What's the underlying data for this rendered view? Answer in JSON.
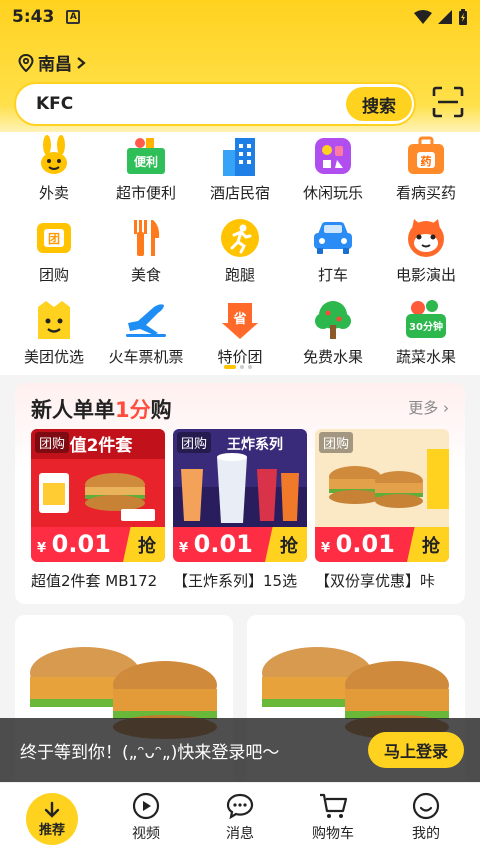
{
  "status": {
    "time": "5:43",
    "notif": "A"
  },
  "location": {
    "city": "南昌"
  },
  "search": {
    "query": "KFC",
    "button": "搜索"
  },
  "categories": [
    {
      "label": "外卖",
      "icon": "kangaroo-icon"
    },
    {
      "label": "超市便利",
      "icon": "supermarket-icon",
      "badge": "便利"
    },
    {
      "label": "酒店民宿",
      "icon": "hotel-icon"
    },
    {
      "label": "休闲玩乐",
      "icon": "leisure-icon"
    },
    {
      "label": "看病买药",
      "icon": "medicine-icon",
      "badge": "药"
    },
    {
      "label": "团购",
      "icon": "group-buy-icon",
      "badge": "团"
    },
    {
      "label": "美食",
      "icon": "fork-knife-icon"
    },
    {
      "label": "跑腿",
      "icon": "errand-icon"
    },
    {
      "label": "打车",
      "icon": "car-icon"
    },
    {
      "label": "电影演出",
      "icon": "cat-movie-icon"
    },
    {
      "label": "美团优选",
      "icon": "bag-icon"
    },
    {
      "label": "火车票机票",
      "icon": "plane-icon"
    },
    {
      "label": "特价团",
      "icon": "discount-icon",
      "badge": "省"
    },
    {
      "label": "免费水果",
      "icon": "tree-icon"
    },
    {
      "label": "蔬菜水果",
      "icon": "veg-icon",
      "badge": "30分钟"
    }
  ],
  "newuser": {
    "title_prefix": "新人单单",
    "title_highlight": "1分",
    "title_suffix": "购",
    "more": "更多",
    "deals": [
      {
        "tag": "团购",
        "currency": "¥",
        "price": "0.01",
        "grab": "抢",
        "name": "超值2件套 MB172",
        "banner": "值2件套"
      },
      {
        "tag": "团购",
        "currency": "¥",
        "price": "0.01",
        "grab": "抢",
        "name": "【王炸系列】15选",
        "banner": "王炸系列"
      },
      {
        "tag": "团购",
        "currency": "¥",
        "price": "0.01",
        "grab": "抢",
        "name": "【双份享优惠】咔",
        "banner": ""
      }
    ]
  },
  "toast": {
    "text": "终于等到你！(„ᵔᴗᵔ„)快来登录吧～",
    "button": "马上登录"
  },
  "nav": [
    {
      "label": "推荐",
      "icon": "arrow-down-icon"
    },
    {
      "label": "视频",
      "icon": "play-icon"
    },
    {
      "label": "消息",
      "icon": "chat-icon"
    },
    {
      "label": "购物车",
      "icon": "cart-icon"
    },
    {
      "label": "我的",
      "icon": "smile-icon"
    }
  ],
  "colors": {
    "brand": "#ffd21f",
    "price": "#ff2d44",
    "highlight": "#ff4c3c"
  }
}
